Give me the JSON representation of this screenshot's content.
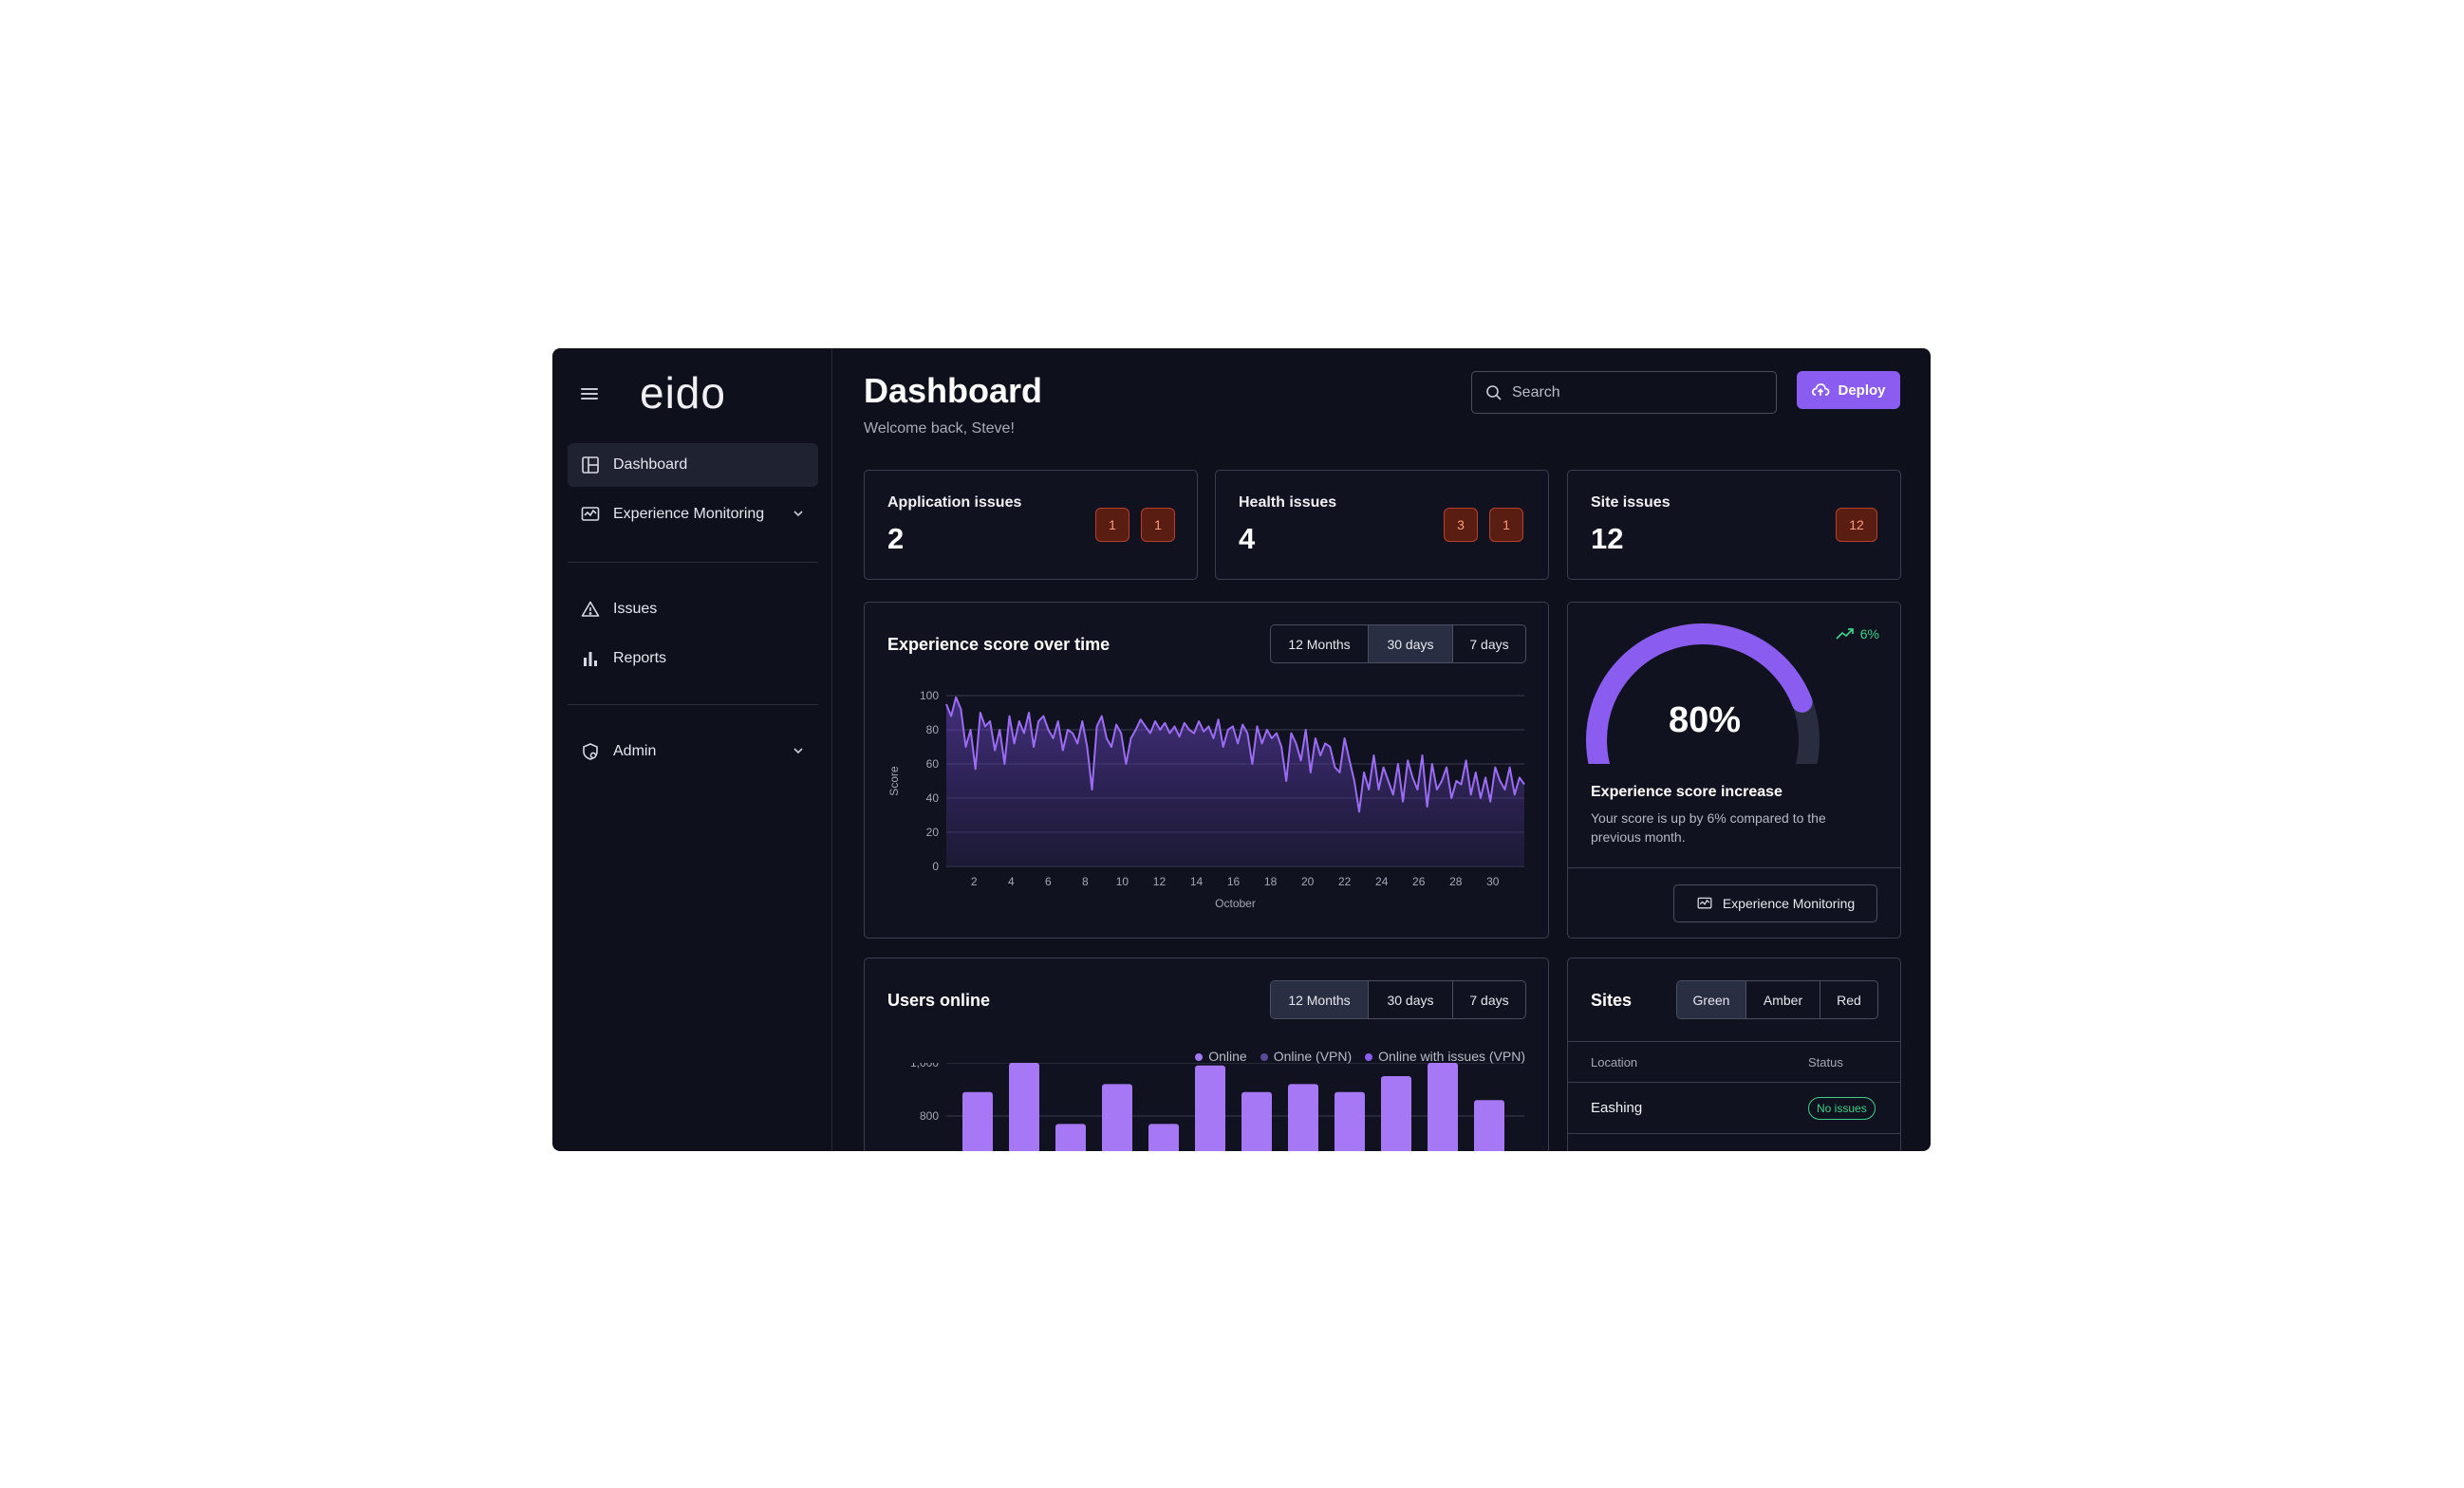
{
  "app": {
    "logo": "eido"
  },
  "sidebar": {
    "items": [
      {
        "label": "Dashboard"
      },
      {
        "label": "Experience Monitoring"
      },
      {
        "label": "Issues"
      },
      {
        "label": "Reports"
      },
      {
        "label": "Admin"
      }
    ]
  },
  "header": {
    "title": "Dashboard",
    "subtitle": "Welcome back, Steve!",
    "search_placeholder": "Search",
    "deploy_label": "Deploy"
  },
  "issues": [
    {
      "label": "Application issues",
      "value": "2",
      "badges": [
        "1",
        "1"
      ]
    },
    {
      "label": "Health issues",
      "value": "4",
      "badges": [
        "3",
        "1"
      ]
    },
    {
      "label": "Site issues",
      "value": "12",
      "badges": [
        "12"
      ]
    }
  ],
  "experience_chart": {
    "title": "Experience score over time",
    "ranges": [
      "12 Months",
      "30 days",
      "7 days"
    ],
    "selected_range": "30 days"
  },
  "gauge": {
    "value": "80%",
    "percent": 80,
    "trend": "6%",
    "title": "Experience score increase",
    "description": "Your score is up by 6% compared to the previous month.",
    "button_label": "Experience Monitoring"
  },
  "users_chart": {
    "title": "Users online",
    "ranges": [
      "12 Months",
      "30 days",
      "7 days"
    ],
    "selected_range": "12 Months",
    "legend": [
      "Online",
      "Online (VPN)",
      "Online with issues (VPN)"
    ]
  },
  "sites": {
    "title": "Sites",
    "filters": [
      "Green",
      "Amber",
      "Red"
    ],
    "selected_filter": "Green",
    "columns": [
      "Location",
      "Status"
    ],
    "rows": [
      {
        "location": "Eashing",
        "status": "No issues"
      }
    ]
  },
  "colors": {
    "accent": "#8a5cf0",
    "success": "#3fd08a",
    "danger": "#b8402a",
    "background": "#0e111c"
  },
  "chart_data": [
    {
      "type": "area",
      "title": "Experience score over time",
      "xlabel": "October",
      "ylabel": "Score",
      "ylim": [
        0,
        100
      ],
      "yticks": [
        0,
        20,
        40,
        60,
        80,
        100
      ],
      "xticks": [
        2,
        4,
        6,
        8,
        10,
        12,
        14,
        16,
        18,
        20,
        22,
        24,
        26,
        28,
        30
      ],
      "xlim": [
        0.5,
        31.7
      ],
      "series": [
        {
          "values": [
            95,
            88,
            99,
            92,
            70,
            80,
            57,
            90,
            82,
            85,
            68,
            80,
            60,
            88,
            72,
            85,
            78,
            90,
            70,
            85,
            88,
            80,
            75,
            85,
            68,
            80,
            78,
            72,
            85,
            70,
            45,
            82,
            88,
            75,
            70,
            83,
            78,
            60,
            75,
            80,
            86,
            82,
            78,
            85,
            80,
            84,
            78,
            82,
            76,
            84,
            80,
            78,
            85,
            79,
            82,
            75,
            86,
            70,
            80,
            82,
            72,
            83,
            78,
            60,
            82,
            72,
            80,
            75,
            78,
            70,
            50,
            78,
            72,
            62,
            80,
            55,
            75,
            65,
            72,
            70,
            58,
            55,
            75,
            62,
            50,
            32,
            55,
            45,
            65,
            45,
            58,
            50,
            42,
            60,
            38,
            62,
            52,
            45,
            65,
            35,
            60,
            45,
            50,
            58,
            40,
            50,
            48,
            62,
            42,
            55,
            40,
            52,
            38,
            58,
            50,
            45,
            58,
            42,
            52,
            48
          ]
        }
      ]
    },
    {
      "type": "bar",
      "title": "Users online",
      "ylim": [
        600,
        1000
      ],
      "yticks": [
        800,
        1000
      ],
      "series": [
        {
          "name": "Online",
          "values": [
            890,
            1000,
            770,
            920,
            770,
            990,
            890,
            920,
            890,
            950,
            1000,
            860
          ]
        }
      ]
    }
  ]
}
